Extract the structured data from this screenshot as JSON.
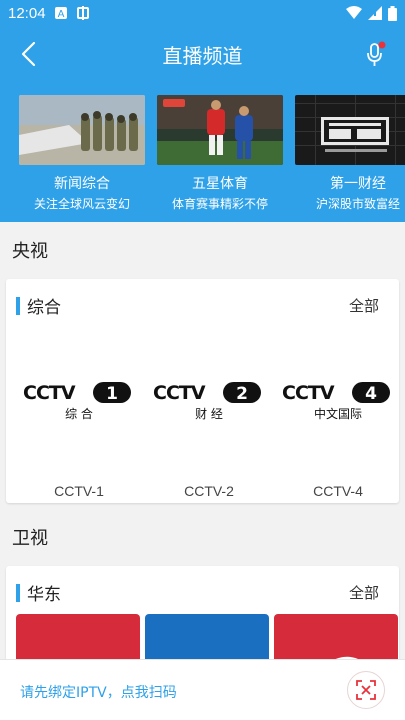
{
  "status_bar": {
    "time": "12:04",
    "icons": [
      "a-box-icon",
      "app-icon"
    ]
  },
  "appbar": {
    "title": "直播频道"
  },
  "featured": [
    {
      "name": "新闻综合",
      "subtitle": "关注全球风云变幻"
    },
    {
      "name": "五星体育",
      "subtitle": "体育赛事精彩不停"
    },
    {
      "name": "第一财经",
      "subtitle": "沪深股市致富经"
    }
  ],
  "sections": [
    {
      "title": "央视",
      "card": {
        "name": "综合",
        "more": "全部",
        "channels": [
          {
            "label": "CCTV-1",
            "logo_number": "1",
            "logo_caption": "综 合"
          },
          {
            "label": "CCTV-2",
            "logo_number": "2",
            "logo_caption": "财 经"
          },
          {
            "label": "CCTV-4",
            "logo_number": "4",
            "logo_caption": "中文国际"
          }
        ]
      }
    },
    {
      "title": "卫视",
      "card": {
        "name": "华东",
        "more": "全部"
      }
    }
  ],
  "bottom_bar": {
    "prompt": "请先绑定IPTV，点我扫码"
  },
  "colors": {
    "brand_blue": "#2ea1e8",
    "tile_red": "#d62b3a",
    "tile_blue": "#1a6fc1"
  }
}
